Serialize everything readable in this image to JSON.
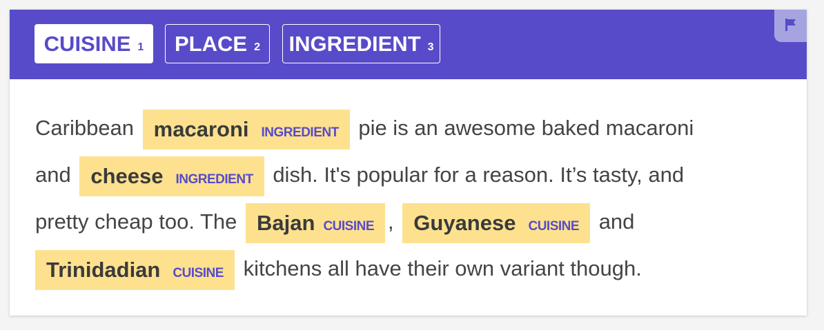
{
  "tabs": [
    {
      "label": "CUISINE",
      "key": "1",
      "active": true
    },
    {
      "label": "PLACE",
      "key": "2",
      "active": false
    },
    {
      "label": "INGREDIENT",
      "key": "3",
      "active": false
    }
  ],
  "colors": {
    "accent": "#584bc9",
    "highlight": "#fde18f",
    "flag_bg": "#a6a4e0"
  },
  "flag_icon": "flag-icon",
  "text": {
    "l1_pre": "Caribbean",
    "ent1": {
      "text": "macaroni",
      "label": "INGREDIENT"
    },
    "l1_post": "pie is an awesome baked macaroni",
    "l2_pre": "and",
    "ent2": {
      "text": "cheese",
      "label": "INGREDIENT"
    },
    "l2_post": "dish. It's popular for a reason. It’s tasty, and",
    "l3_pre": "pretty cheap too. The",
    "ent3": {
      "text": "Bajan",
      "label": "CUISINE"
    },
    "l3_comma": ",",
    "ent4": {
      "text": "Guyanese",
      "label": "CUISINE"
    },
    "l3_post": "and",
    "ent5": {
      "text": "Trinidadian",
      "label": "CUISINE"
    },
    "l4_post": "kitchens all have their own variant though."
  }
}
